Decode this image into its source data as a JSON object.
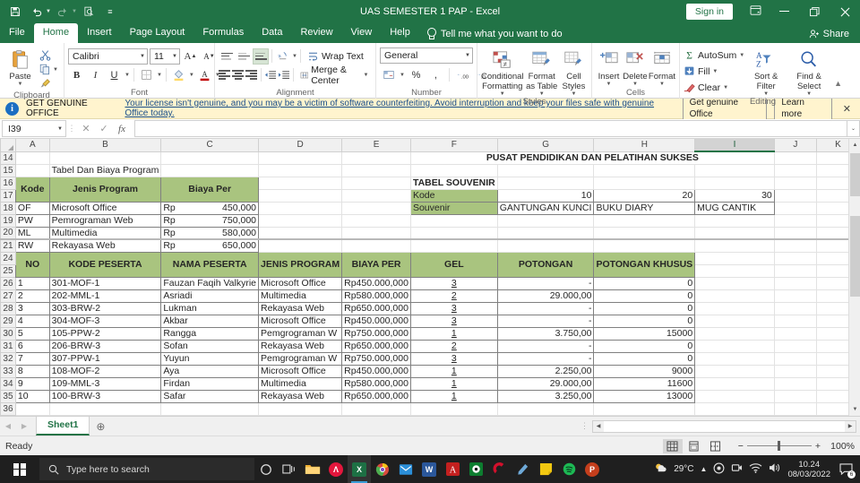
{
  "titlebar": {
    "document_title": "UAS SEMESTER 1 PAP  -  Excel",
    "signin_label": "Sign in",
    "qat": [
      {
        "name": "save-icon",
        "glyph": "💾"
      },
      {
        "name": "undo-icon",
        "glyph": "↶"
      },
      {
        "name": "redo-icon",
        "glyph": "↷"
      },
      {
        "name": "print-preview-icon",
        "glyph": "🔍"
      },
      {
        "name": "customize-qat-icon",
        "glyph": "≡"
      }
    ],
    "ribbon_display_options": "❐",
    "minimize": "─",
    "restore": "❐",
    "close": "✕"
  },
  "tabs": [
    {
      "label": "File",
      "active": false
    },
    {
      "label": "Home",
      "active": true
    },
    {
      "label": "Insert",
      "active": false
    },
    {
      "label": "Page Layout",
      "active": false
    },
    {
      "label": "Formulas",
      "active": false
    },
    {
      "label": "Data",
      "active": false
    },
    {
      "label": "Review",
      "active": false
    },
    {
      "label": "View",
      "active": false
    },
    {
      "label": "Help",
      "active": false
    }
  ],
  "tell_me": "Tell me what you want to do",
  "share_label": "Share",
  "ribbon": {
    "clipboard": {
      "group_label": "Clipboard",
      "paste_label": "Paste",
      "cut_label": "Cut",
      "copy_label": "Copy",
      "format_painter_label": "Format Painter"
    },
    "font": {
      "group_label": "Font",
      "font_name": "Calibri",
      "font_size": "11",
      "grow_font": "A",
      "shrink_font": "A",
      "bold": "B",
      "italic": "I",
      "underline": "U",
      "borders": "⊞",
      "fill_color": "A",
      "font_color": "A"
    },
    "alignment": {
      "group_label": "Alignment",
      "wrap_text_label": "Wrap Text",
      "merge_center_label": "Merge & Center",
      "orientation": "⟳"
    },
    "number": {
      "group_label": "Number",
      "format": "General",
      "percent": "%",
      "comma": ",",
      "increase_decimal": "←.0",
      "decrease_decimal": "→.0"
    },
    "styles": {
      "group_label": "Styles",
      "conditional_formatting": "Conditional Formatting",
      "format_as_table": "Format as Table",
      "cell_styles": "Cell Styles"
    },
    "cells": {
      "group_label": "Cells",
      "insert": "Insert",
      "delete": "Delete",
      "format": "Format"
    },
    "editing": {
      "group_label": "Editing",
      "autosum": "AutoSum",
      "fill": "Fill",
      "clear": "Clear",
      "sort_filter": "Sort & Filter",
      "find_select": "Find & Select"
    }
  },
  "notice": {
    "title": "GET GENUINE OFFICE",
    "message": "Your license isn't genuine, and you may be a victim of software counterfeiting. Avoid interruption and keep your files safe with genuine Office today.",
    "primary_button": "Get genuine Office",
    "secondary_button": "Learn more",
    "close": "✕"
  },
  "formula_bar": {
    "name_box": "I39",
    "cancel": "✕",
    "enter": "✓",
    "insert_function": "fx",
    "formula_value": "",
    "expand": "⌄"
  },
  "grid": {
    "columns": [
      "A",
      "B",
      "C",
      "D",
      "E",
      "F",
      "G",
      "H",
      "I",
      "J",
      "K"
    ],
    "selected_column": "I",
    "row_numbers": [
      "14",
      "15",
      "16",
      "17",
      "18",
      "19",
      "20",
      "21",
      "24",
      "25",
      "26",
      "27",
      "28",
      "29",
      "30",
      "31",
      "32",
      "33",
      "34",
      "35",
      "36"
    ],
    "heading_title": "PUSAT PENDIDIKAN DAN PELATIHAN SUKSES",
    "subtitle_program": "Tabel Dan Biaya Program",
    "program_table": {
      "headers": [
        "Kode",
        "Jenis Program",
        "Biaya Per"
      ],
      "rows": [
        {
          "kode": "OF",
          "program": "Microsoft Office",
          "cur": "Rp",
          "biaya": "450,000"
        },
        {
          "kode": "PW",
          "program": "Pemrograman Web",
          "cur": "Rp",
          "biaya": "750,000"
        },
        {
          "kode": "ML",
          "program": "Multimedia",
          "cur": "Rp",
          "biaya": "580,000"
        },
        {
          "kode": "RW",
          "program": "Rekayasa Web",
          "cur": "Rp",
          "biaya": "650,000"
        }
      ]
    },
    "souvenir_table": {
      "title": "TABEL SOUVENIR",
      "kode_label": "Kode",
      "souvenir_label": "Souvenir",
      "kode_values": [
        "10",
        "20",
        "30"
      ],
      "souvenir_values": [
        "GANTUNGAN KUNCI",
        "BUKU DIARY",
        "MUG CANTIK"
      ]
    },
    "main_table": {
      "headers": [
        "NO",
        "KODE PESERTA",
        "NAMA PESERTA",
        "JENIS PROGRAM",
        "BIAYA PER",
        "GEL",
        "POTONGAN",
        "POTONGAN KHUSUS"
      ],
      "rows": [
        {
          "no": "1",
          "kode": "301-MOF-1",
          "nama": "Fauzan Faqih Valkyrie",
          "program": "Microsoft Office",
          "biaya": "Rp450.000,000",
          "gel": "3",
          "potongan": "-",
          "khusus": "0"
        },
        {
          "no": "2",
          "kode": "202-MML-1",
          "nama": "Asriadi",
          "program": "Multimedia",
          "biaya": "Rp580.000,000",
          "gel": "2",
          "potongan": "29.000,00",
          "khusus": "0"
        },
        {
          "no": "3",
          "kode": "303-BRW-2",
          "nama": "Lukman",
          "program": "Rekayasa Web",
          "biaya": "Rp650.000,000",
          "gel": "3",
          "potongan": "-",
          "khusus": "0"
        },
        {
          "no": "4",
          "kode": "304-MOF-3",
          "nama": "Akbar",
          "program": "Microsoft Office",
          "biaya": "Rp450.000,000",
          "gel": "3",
          "potongan": "-",
          "khusus": "0"
        },
        {
          "no": "5",
          "kode": "105-PPW-2",
          "nama": "Rangga",
          "program": "Pemgrograman W",
          "biaya": "Rp750.000,000",
          "gel": "1",
          "potongan": "3.750,00",
          "khusus": "15000"
        },
        {
          "no": "6",
          "kode": "206-BRW-3",
          "nama": "Sofan",
          "program": "Rekayasa Web",
          "biaya": "Rp650.000,000",
          "gel": "2",
          "potongan": "-",
          "khusus": "0"
        },
        {
          "no": "7",
          "kode": "307-PPW-1",
          "nama": "Yuyun",
          "program": "Pemgrograman W",
          "biaya": "Rp750.000,000",
          "gel": "3",
          "potongan": "-",
          "khusus": "0"
        },
        {
          "no": "8",
          "kode": "108-MOF-2",
          "nama": "Aya",
          "program": "Microsoft Office",
          "biaya": "Rp450.000,000",
          "gel": "1",
          "potongan": "2.250,00",
          "khusus": "9000"
        },
        {
          "no": "9",
          "kode": "109-MML-3",
          "nama": "Firdan",
          "program": "Multimedia",
          "biaya": "Rp580.000,000",
          "gel": "1",
          "potongan": "29.000,00",
          "khusus": "11600"
        },
        {
          "no": "10",
          "kode": "100-BRW-3",
          "nama": "Safar",
          "program": "Rekayasa Web",
          "biaya": "Rp650.000,000",
          "gel": "1",
          "potongan": "3.250,00",
          "khusus": "13000"
        }
      ]
    }
  },
  "sheet_bar": {
    "sheets": [
      "Sheet1"
    ],
    "active_sheet": "Sheet1",
    "add_sheet": "+"
  },
  "status_bar": {
    "status": "Ready",
    "zoom": "100%",
    "views": [
      "normal-view",
      "page-layout-view",
      "page-break-view"
    ]
  },
  "taskbar": {
    "search_placeholder": "Type here to search",
    "weather_temp": "29°C",
    "clock_time": "10.24",
    "clock_date": "08/03/2022",
    "notification_count": "6",
    "apps": [
      {
        "name": "file-explorer-icon",
        "glyph": "📁",
        "color": "#f2b134",
        "text": ""
      },
      {
        "name": "avast-icon",
        "glyph": "",
        "color": "#e3163c",
        "text": "Λ"
      },
      {
        "name": "excel-icon",
        "glyph": "",
        "color": "#1d7044",
        "text": "X"
      },
      {
        "name": "chrome-icon",
        "glyph": "",
        "color": "#d94a3d",
        "text": ""
      },
      {
        "name": "mail-icon",
        "glyph": "✉",
        "color": "#2b8fd9",
        "text": ""
      },
      {
        "name": "word-icon",
        "glyph": "",
        "color": "#2b579a",
        "text": "W"
      },
      {
        "name": "acrobat-icon",
        "glyph": "",
        "color": "#c4201f",
        "text": "A"
      },
      {
        "name": "media-player-icon",
        "glyph": "◉",
        "color": "#0d7d2f",
        "text": ""
      },
      {
        "name": "camtasia-icon",
        "glyph": "C",
        "color": "#d2102c",
        "text": ""
      },
      {
        "name": "lightshot-icon",
        "glyph": "✒",
        "color": "#6ea9d8",
        "text": ""
      },
      {
        "name": "sticky-notes-icon",
        "glyph": "",
        "color": "#f2c811",
        "text": ""
      },
      {
        "name": "spotify-icon",
        "glyph": "♫",
        "color": "#1db954",
        "text": ""
      },
      {
        "name": "powerpoint-icon",
        "glyph": "",
        "color": "#c43e1c",
        "text": "P"
      }
    ]
  }
}
